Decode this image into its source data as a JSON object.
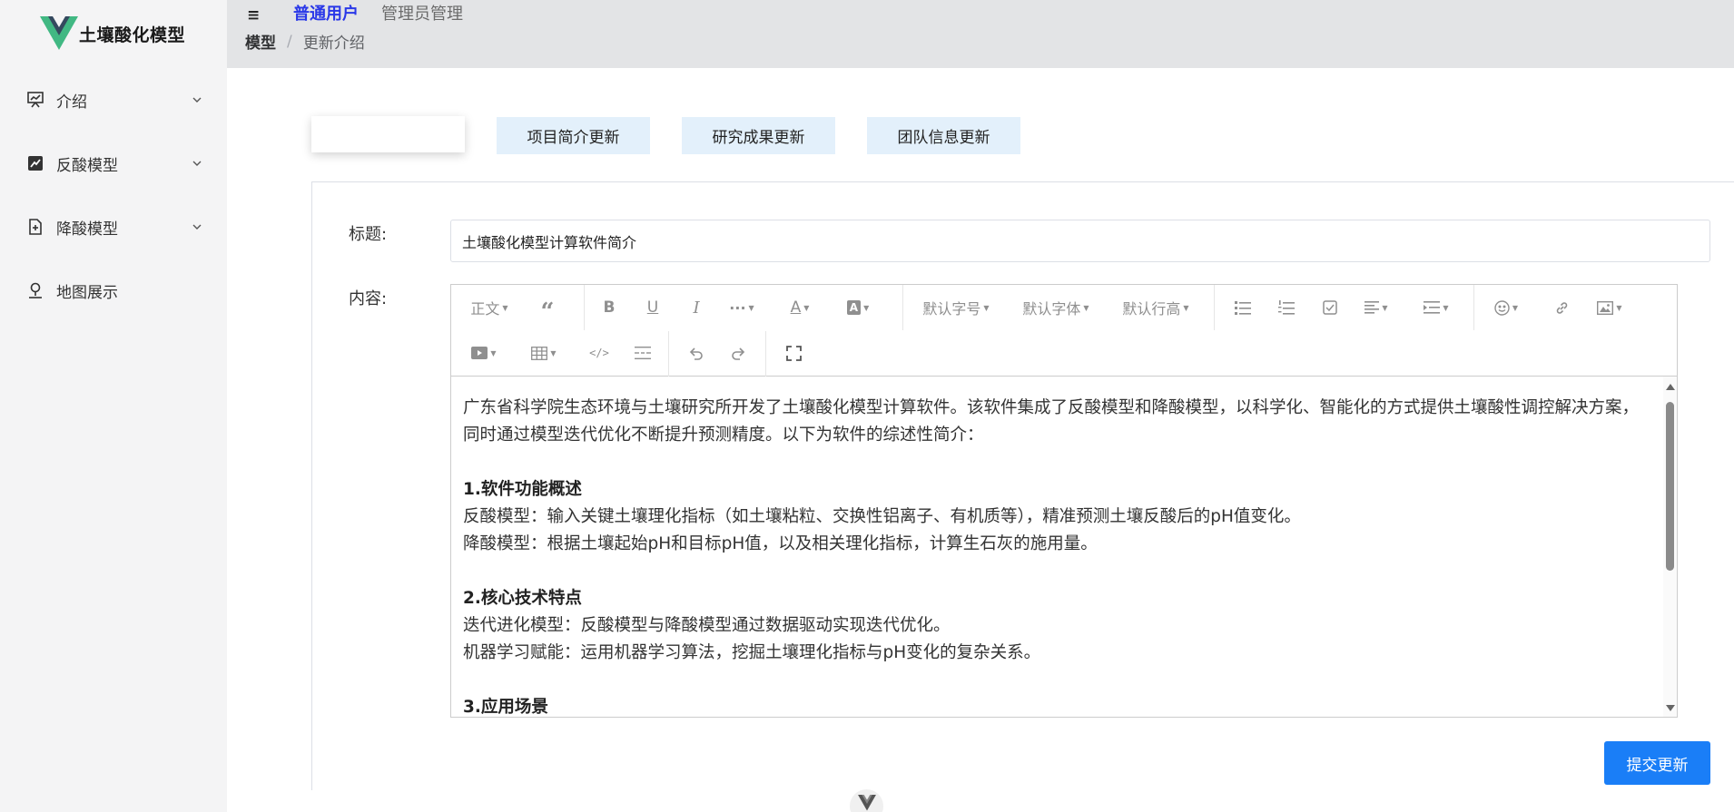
{
  "app": {
    "logo_text": "土壤酸化模型",
    "brand_color": "#41b883",
    "brand_dark": "#34495e"
  },
  "sidebar": {
    "items": [
      {
        "label": "介绍",
        "icon": "presentation-icon",
        "expandable": true
      },
      {
        "label": "反酸模型",
        "icon": "trend-chart-icon",
        "expandable": true
      },
      {
        "label": "降酸模型",
        "icon": "document-add-icon",
        "expandable": true
      },
      {
        "label": "地图展示",
        "icon": "location-pin-icon",
        "expandable": false
      }
    ]
  },
  "header": {
    "nav_user": "普通用户",
    "nav_admin": "管理员管理",
    "active_color": "#2a38e8",
    "breadcrumb": [
      "模型",
      "更新介绍"
    ]
  },
  "tabs": {
    "items": [
      "项目简介更新",
      "研究成果更新",
      "团队信息更新"
    ],
    "tab_bg": "#e3f0fb"
  },
  "form": {
    "title_label": "标题:",
    "title_value": "土壤酸化模型计算软件简介",
    "content_label": "内容:",
    "submit_label": "提交更新",
    "submit_color": "#1a7ef7"
  },
  "editor": {
    "toolbar": {
      "paragraph": "正文",
      "font_size": "默认字号",
      "font_family": "默认字体",
      "line_height": "默认行高",
      "more": "···"
    },
    "content": {
      "intro": "广东省科学院生态环境与土壤研究所开发了土壤酸化模型计算软件。该软件集成了反酸模型和降酸模型，以科学化、智能化的方式提供土壤酸性调控解决方案，同时通过模型迭代优化不断提升预测精度。以下为软件的综述性简介：",
      "h1": "1.软件功能概述",
      "p1a": "反酸模型：输入关键土壤理化指标（如土壤粘粒、交换性铝离子、有机质等），精准预测土壤反酸后的pH值变化。",
      "p1b": "降酸模型：根据土壤起始pH和目标pH值，以及相关理化指标，计算生石灰的施用量。",
      "h2": "2.核心技术特点",
      "p2a": "迭代进化模型：反酸模型与降酸模型通过数据驱动实现迭代优化。",
      "p2b": "机器学习赋能：运用机器学习算法，挖掘土壤理化指标与pH变化的复杂关系。",
      "h3": "3.应用场景"
    }
  }
}
